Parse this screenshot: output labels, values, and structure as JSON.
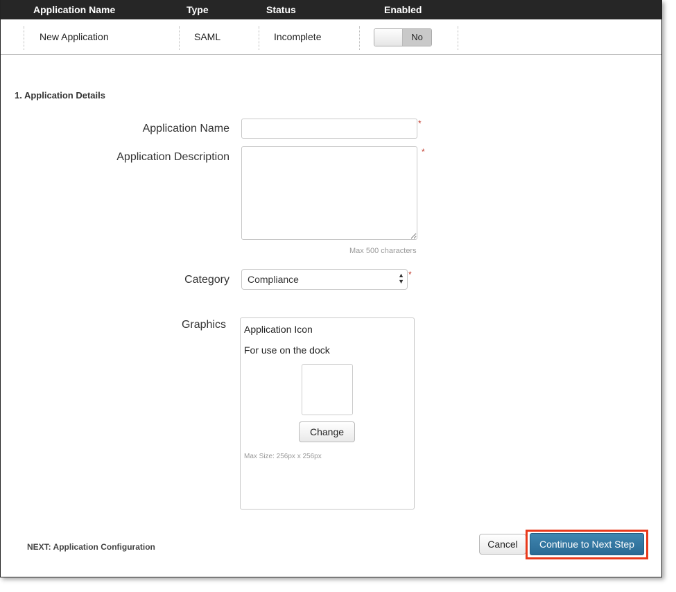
{
  "table": {
    "headers": [
      "Application Name",
      "Type",
      "Status",
      "Enabled"
    ],
    "row": {
      "name": "New Application",
      "type": "SAML",
      "status": "Incomplete",
      "enabled_label": "No"
    }
  },
  "form": {
    "section_title": "1. Application Details",
    "required_marker": "*",
    "app_name": {
      "label": "Application Name",
      "value": ""
    },
    "app_description": {
      "label": "Application Description",
      "value": "",
      "hint": "Max 500 characters"
    },
    "category": {
      "label": "Category",
      "selected": "Compliance"
    },
    "graphics": {
      "label": "Graphics",
      "box_title": "Application Icon",
      "box_subtitle": "For use on the dock",
      "change_label": "Change",
      "max_size": "Max Size: 256px x 256px"
    }
  },
  "footer": {
    "next_text": "NEXT: Application Configuration",
    "cancel_label": "Cancel",
    "continue_label": "Continue to Next Step"
  },
  "colors": {
    "header_bg": "#262626",
    "primary_button": "#2f7aa6",
    "highlight_outline": "#e8391b",
    "required": "#c0392b"
  }
}
